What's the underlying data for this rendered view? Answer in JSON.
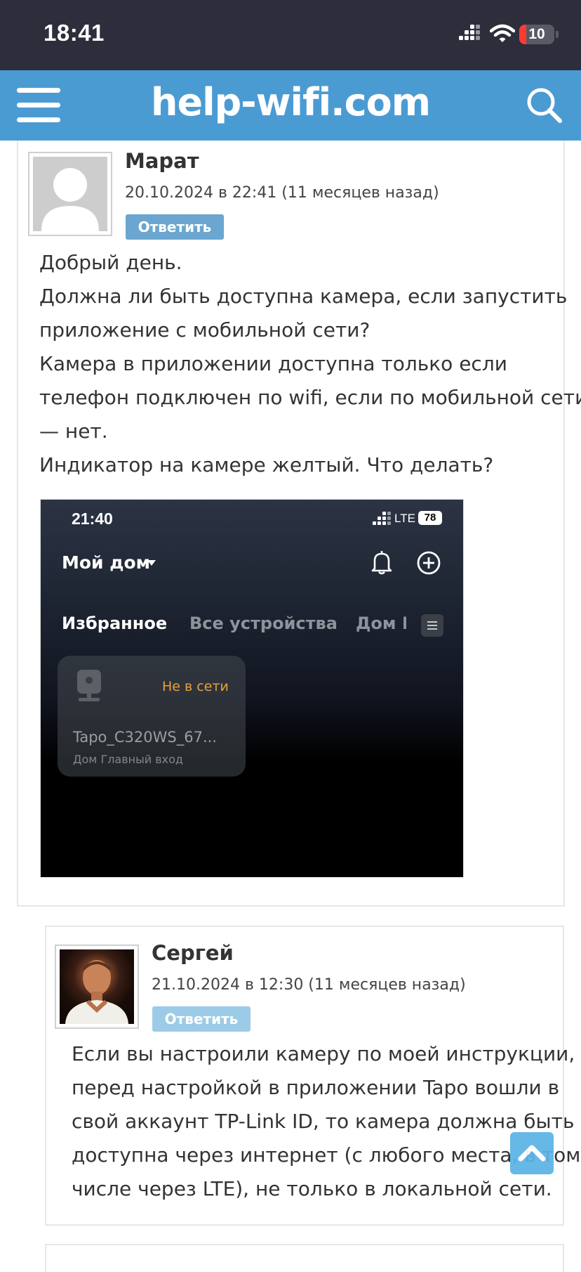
{
  "status_bar": {
    "time": "18:41",
    "battery": "10"
  },
  "header": {
    "site_title": "help-wifi.com"
  },
  "comments": [
    {
      "author": "Марат",
      "date": "20.10.2024 в 22:41 (11 месяцев назад)",
      "reply_label": "Ответить",
      "text_lines": [
        "Добрый день.",
        "Должна ли быть доступна камера, если запустить",
        "приложение с мобильной сети?",
        "Камера в приложении доступна только если",
        "телефон подключен по wifi, если по мобильной сети",
        "— нет.",
        "Индикатор на камере желтый. Что делать?"
      ],
      "attachment": {
        "time": "21:40",
        "network": "LTE",
        "battery": "78",
        "home_title": "Мой дом",
        "tabs": [
          "Избранное",
          "Все устройства",
          "Дом Г"
        ],
        "device": {
          "status": "Не в сети",
          "name": "Tapo_C320WS_67...",
          "location": "Дом Главный вход"
        }
      }
    },
    {
      "author": "Сергей",
      "date": "21.10.2024 в 12:30 (11 месяцев назад)",
      "reply_label": "Ответить",
      "text_lines": [
        "Если вы настроили камеру по моей инструкции,",
        "перед настройкой в приложении Tapo вошли в",
        "свой аккаунт TP-Link ID, то камера должна быть",
        "доступна через интернет (с любого места, в том",
        "числе через LTE), не только в локальной сети."
      ]
    }
  ],
  "colors": {
    "header_bg": "#4b9bd3",
    "reply_button": "#6aa6cf",
    "reply_button_light": "#9ccbe8",
    "offline": "#e6a23c"
  },
  "icons": {
    "menu": "hamburger-icon",
    "search": "search-icon",
    "scroll_top": "chevron-up-icon"
  }
}
